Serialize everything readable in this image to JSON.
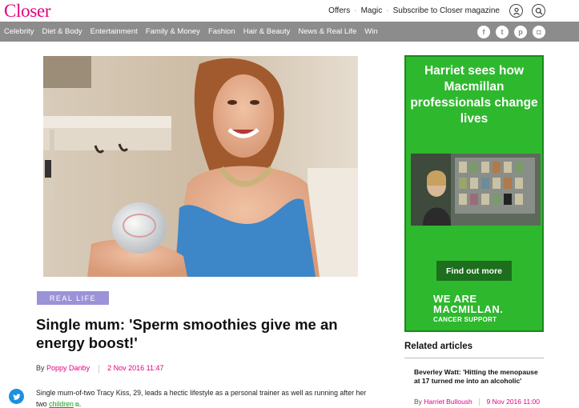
{
  "header": {
    "logo": "Closer",
    "links": [
      "Offers",
      "Magic",
      "Subscribe to Closer magazine"
    ],
    "separator": "·",
    "icons": [
      "user-icon",
      "search-icon"
    ]
  },
  "nav": {
    "items": [
      "Celebrity",
      "Diet & Body",
      "Entertainment",
      "Family & Money",
      "Fashion",
      "Hair & Beauty",
      "News & Real Life",
      "Win"
    ],
    "social": [
      {
        "name": "facebook-icon",
        "glyph": "f"
      },
      {
        "name": "twitter-icon",
        "glyph": "t"
      },
      {
        "name": "pinterest-icon",
        "glyph": "p"
      },
      {
        "name": "instagram-icon",
        "glyph": "◘"
      }
    ]
  },
  "article": {
    "category": "REAL LIFE",
    "headline": "Single mum: 'Sperm smoothies give me an energy boost!'",
    "by": "By",
    "author": "Poppy Danby",
    "date": "2 Nov 2016 11:47",
    "body_before_link": "Single mum-of-two Tracy Kiss, 29, leads a hectic lifestyle as a personal trainer as well as running after her two ",
    "body_link": "children",
    "body_after_link": "."
  },
  "ad": {
    "headline": "Harriet sees how Macmillan professionals change lives",
    "button": "Find out more",
    "logo_line1": "WE ARE MACMILLAN.",
    "logo_line2": "CANCER SUPPORT"
  },
  "related": {
    "title": "Related articles",
    "items": [
      {
        "title": "Beverley Watt: 'Hitting the menopause at 17 turned me into an alcoholic'",
        "by": "By",
        "author": "Harriet Bulloush",
        "date": "9 Nov 2016 11:00"
      }
    ]
  },
  "colors": {
    "brand": "#e3007e",
    "nav_bg": "#8c8c8c",
    "badge": "#9b93d8",
    "ad_green": "#2eb82e",
    "twitter": "#1d8fe0"
  }
}
